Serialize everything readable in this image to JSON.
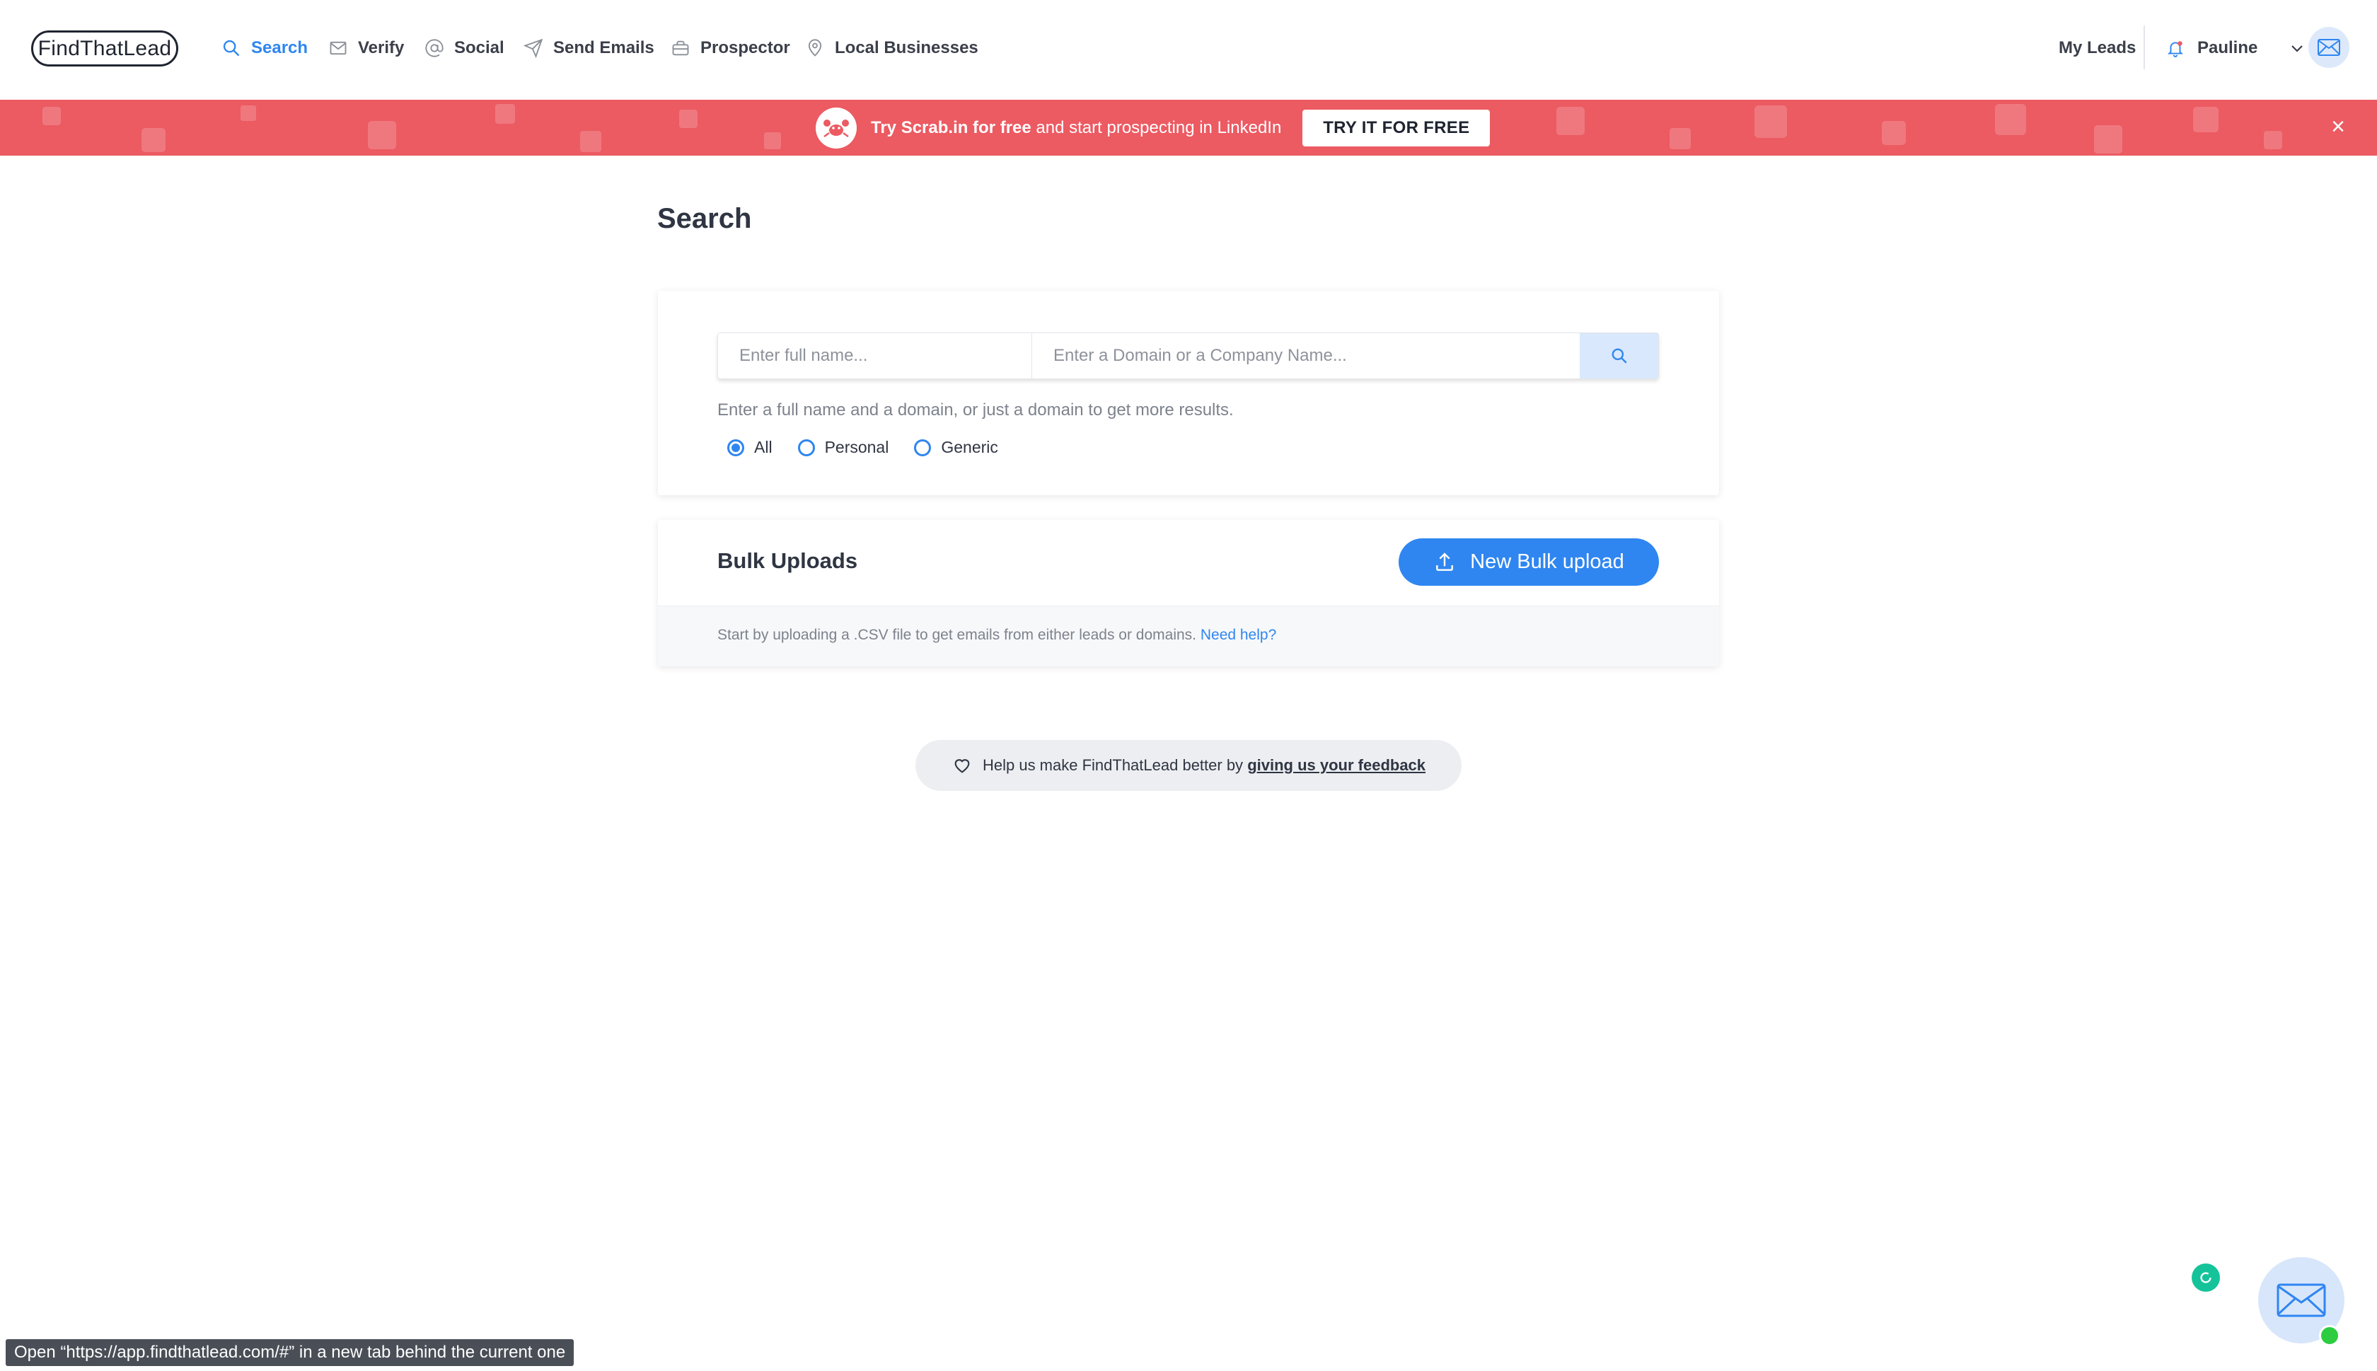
{
  "app": {
    "logo": "FindThatLead"
  },
  "nav": {
    "items": [
      {
        "label": "Search",
        "icon": "search-icon",
        "active": true
      },
      {
        "label": "Verify",
        "icon": "envelope-icon",
        "active": false
      },
      {
        "label": "Social",
        "icon": "at-sign-icon",
        "active": false
      },
      {
        "label": "Send Emails",
        "icon": "paper-plane-icon",
        "active": false
      },
      {
        "label": "Prospector",
        "icon": "briefcase-icon",
        "active": false
      },
      {
        "label": "Local Businesses",
        "icon": "map-pin-icon",
        "active": false
      }
    ],
    "my_leads": "My Leads",
    "user_name": "Pauline"
  },
  "banner": {
    "strong": "Try Scrab.in for free",
    "rest": " and start prospecting in LinkedIn",
    "button": "TRY IT FOR FREE",
    "close": "×",
    "color": "#ec5a62"
  },
  "page": {
    "title": "Search"
  },
  "search": {
    "name_placeholder": "Enter full name...",
    "domain_placeholder": "Enter a Domain or a Company Name...",
    "helper": "Enter a full name and a domain, or just a domain to get more results.",
    "filters": [
      {
        "label": "All",
        "selected": true
      },
      {
        "label": "Personal",
        "selected": false
      },
      {
        "label": "Generic",
        "selected": false
      }
    ]
  },
  "bulk": {
    "title": "Bulk Uploads",
    "button": "New Bulk upload",
    "description": "Start by uploading a .CSV file to get emails from either leads or domains. ",
    "help_link": "Need help?"
  },
  "feedback": {
    "text": "Help us make FindThatLead better by ",
    "link": "giving us your feedback"
  },
  "status_bar": {
    "text": "Open “https://app.findthatlead.com/#” in a new tab behind the current one"
  },
  "colors": {
    "accent": "#2f86f0",
    "text": "#2f3542"
  }
}
